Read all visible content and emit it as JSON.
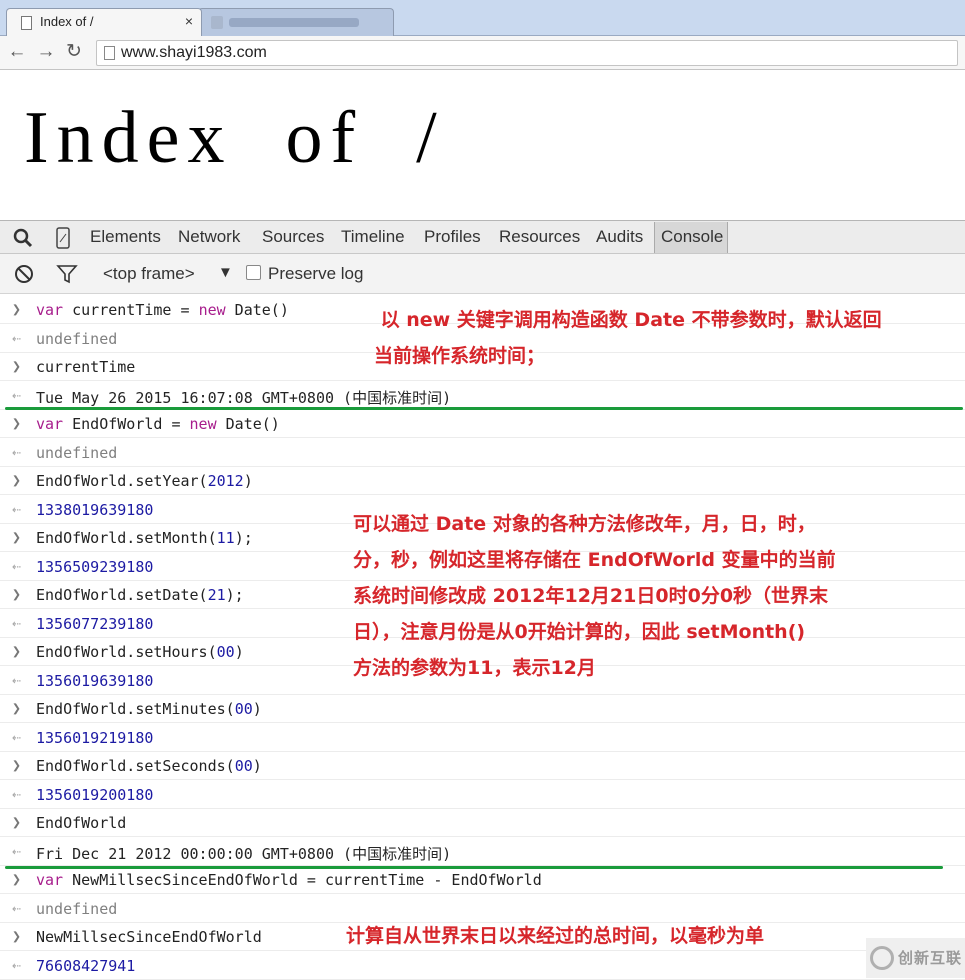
{
  "browser": {
    "tab_title": "Index of /",
    "tab_close": "×",
    "url": "www.shayi1983.com"
  },
  "page": {
    "heading": "Index  of  /"
  },
  "devtools": {
    "tabs": [
      "Elements",
      "Network",
      "Sources",
      "Timeline",
      "Profiles",
      "Resources",
      "Audits",
      "Console"
    ],
    "selected_tab": "Console",
    "frame": "<top frame>",
    "frame_arrow": "▼",
    "preserve_log_label": "Preserve log"
  },
  "console": {
    "rows": [
      {
        "kind": "input",
        "text": "var currentTime = new Date()"
      },
      {
        "kind": "result",
        "text": "undefined"
      },
      {
        "kind": "input",
        "text": "currentTime"
      },
      {
        "kind": "result",
        "text": "Tue May 26 2015 16:07:08 GMT+0800 (中国标准时间)"
      },
      {
        "kind": "input",
        "text": "var EndOfWorld = new Date()"
      },
      {
        "kind": "result",
        "text": "undefined"
      },
      {
        "kind": "input",
        "text": "EndOfWorld.setYear(2012)"
      },
      {
        "kind": "result",
        "text": "1338019639180"
      },
      {
        "kind": "input",
        "text": "EndOfWorld.setMonth(11);"
      },
      {
        "kind": "result",
        "text": "1356509239180"
      },
      {
        "kind": "input",
        "text": "EndOfWorld.setDate(21);"
      },
      {
        "kind": "result",
        "text": "1356077239180"
      },
      {
        "kind": "input",
        "text": "EndOfWorld.setHours(00)"
      },
      {
        "kind": "result",
        "text": "1356019639180"
      },
      {
        "kind": "input",
        "text": "EndOfWorld.setMinutes(00)"
      },
      {
        "kind": "result",
        "text": "1356019219180"
      },
      {
        "kind": "input",
        "text": "EndOfWorld.setSeconds(00)"
      },
      {
        "kind": "result",
        "text": "1356019200180"
      },
      {
        "kind": "input",
        "text": "EndOfWorld"
      },
      {
        "kind": "result",
        "text": "Fri Dec 21 2012 00:00:00 GMT+0800 (中国标准时间)"
      },
      {
        "kind": "input",
        "text": "var NewMillsecSinceEndOfWorld = currentTime - EndOfWorld"
      },
      {
        "kind": "result",
        "text": "undefined"
      },
      {
        "kind": "input",
        "text": "NewMillsecSinceEndOfWorld"
      },
      {
        "kind": "result",
        "text": "76608427941"
      }
    ]
  },
  "annotations": {
    "note1": " 以 new 关键字调用构造函数 Date 不带参数时，默认返回\n当前操作系统时间；",
    "note2": "可以通过 Date 对象的各种方法修改年，月，日，时，\n分，秒，例如这里将存储在 EndOfWorld 变量中的当前\n系统时间修改成 2012年12月21日0时0分0秒（世界末\n日），注意月份是从0开始计算的，因此 setMonth()\n方法的参数为11，表示12月",
    "note3": "计算自从世界末日以来经过的总时间，以毫秒为单"
  },
  "colors": {
    "annotation": "#d6262b",
    "divider_line": "#1a9b3b",
    "keyword": "#a71d8c",
    "number": "#1c1aa3"
  },
  "watermark": {
    "text": "创新互联"
  }
}
